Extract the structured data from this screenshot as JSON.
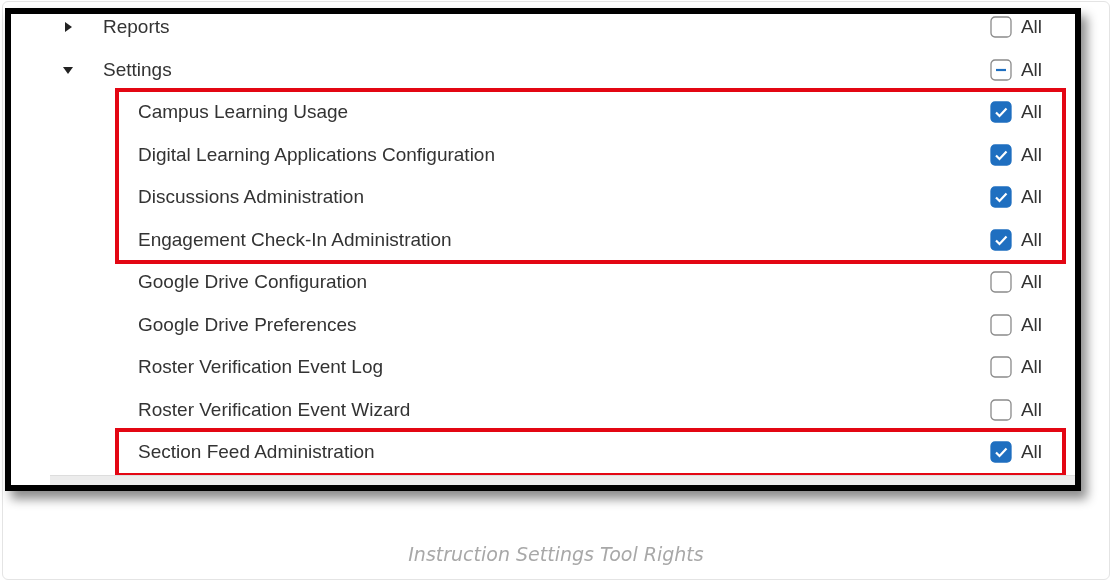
{
  "tree": [
    {
      "label": "Reports",
      "expanded": false,
      "checked": false,
      "indeterminate": false,
      "check_label": "All"
    },
    {
      "label": "Settings",
      "expanded": true,
      "checked": false,
      "indeterminate": true,
      "check_label": "All",
      "children": [
        {
          "label": "Campus Learning Usage",
          "checked": true,
          "indeterminate": false,
          "check_label": "All",
          "highlighted": true
        },
        {
          "label": "Digital Learning Applications Configuration",
          "checked": true,
          "indeterminate": false,
          "check_label": "All",
          "highlighted": true
        },
        {
          "label": "Discussions Administration",
          "checked": true,
          "indeterminate": false,
          "check_label": "All",
          "highlighted": true
        },
        {
          "label": "Engagement Check-In Administration",
          "checked": true,
          "indeterminate": false,
          "check_label": "All",
          "highlighted": true
        },
        {
          "label": "Google Drive Configuration",
          "checked": false,
          "indeterminate": false,
          "check_label": "All",
          "highlighted": false
        },
        {
          "label": "Google Drive Preferences",
          "checked": false,
          "indeterminate": false,
          "check_label": "All",
          "highlighted": false
        },
        {
          "label": "Roster Verification Event Log",
          "checked": false,
          "indeterminate": false,
          "check_label": "All",
          "highlighted": false
        },
        {
          "label": "Roster Verification Event Wizard",
          "checked": false,
          "indeterminate": false,
          "check_label": "All",
          "highlighted": false
        },
        {
          "label": "Section Feed Administration",
          "checked": true,
          "indeterminate": false,
          "check_label": "All",
          "highlighted": true
        }
      ]
    }
  ],
  "caption": "Instruction Settings Tool Rights"
}
